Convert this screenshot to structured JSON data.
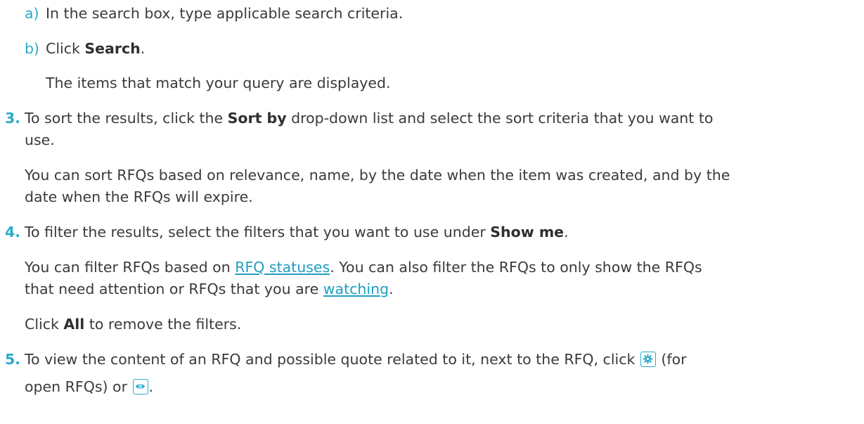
{
  "substeps": [
    {
      "marker": "a)",
      "text": "In the search box, type applicable search criteria."
    },
    {
      "marker": "b)",
      "prefix": "Click ",
      "bold": "Search",
      "suffix": "."
    }
  ],
  "substep_result": "The items that match your query are displayed.",
  "step3": {
    "number": "3.",
    "line1_prefix": "To sort the results, click the ",
    "line1_bold": "Sort by",
    "line1_suffix": " drop-down list and select the sort criteria that you want to",
    "line2": "use.",
    "note_line1": "You can sort RFQs based on relevance, name, by the date when the item was created, and by the",
    "note_line2": "date when the RFQs will expire."
  },
  "step4": {
    "number": "4.",
    "prefix": "To filter the results, select the filters that you want to use under ",
    "bold": "Show me",
    "suffix": ".",
    "note_line1_prefix": "You can filter RFQs based on ",
    "note_line1_link": "RFQ statuses",
    "note_line1_suffix": ". You can also filter the RFQs to only show the RFQs",
    "note_line2_prefix": "that need attention or RFQs that you are ",
    "note_line2_link": "watching",
    "note_line2_suffix": ".",
    "remove_prefix": "Click ",
    "remove_bold": "All",
    "remove_suffix": " to remove the filters."
  },
  "step5": {
    "number": "5.",
    "line1_prefix": "To view the content of an RFQ and possible quote related to it, next to the RFQ, click ",
    "line1_suffix": " (for",
    "line2_prefix": "open RFQs) or ",
    "line2_suffix": ".",
    "icon1": "gear-icon",
    "icon2": "eye-icon"
  },
  "colors": {
    "accent": "#2aaac9",
    "link": "#1f9ec0",
    "text": "#3a3a3a"
  }
}
